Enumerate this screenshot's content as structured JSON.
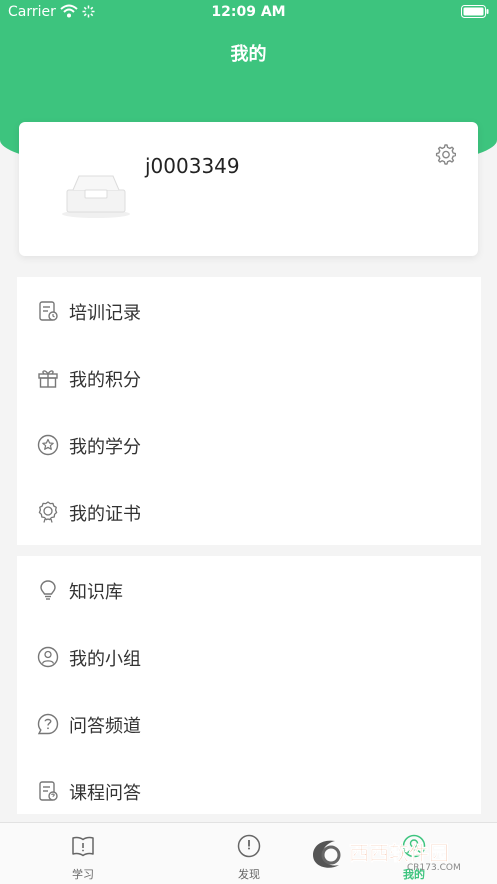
{
  "status_bar": {
    "carrier": "Carrier",
    "time": "12:09 AM"
  },
  "header": {
    "title": "我的"
  },
  "profile": {
    "username": "j0003349",
    "settings_icon": "gear-icon"
  },
  "menu_group_1": [
    {
      "label": "培训记录",
      "icon": "training-record-icon"
    },
    {
      "label": "我的积分",
      "icon": "gift-icon"
    },
    {
      "label": "我的学分",
      "icon": "star-circle-icon"
    },
    {
      "label": "我的证书",
      "icon": "certificate-icon"
    }
  ],
  "menu_group_2": [
    {
      "label": "知识库",
      "icon": "lightbulb-icon"
    },
    {
      "label": "我的小组",
      "icon": "group-icon"
    },
    {
      "label": "问答频道",
      "icon": "question-icon"
    },
    {
      "label": "课程问答",
      "icon": "course-qa-icon"
    }
  ],
  "tab_bar": {
    "tabs": [
      {
        "label": "学习",
        "icon": "book-icon"
      },
      {
        "label": "发现",
        "icon": "compass-icon"
      },
      {
        "label": "我的",
        "icon": "profile-icon"
      }
    ],
    "active_index": 2
  },
  "colors": {
    "accent": "#3dc47e"
  },
  "watermark": {
    "text": "西西软件园",
    "sub": "CR173.COM"
  }
}
